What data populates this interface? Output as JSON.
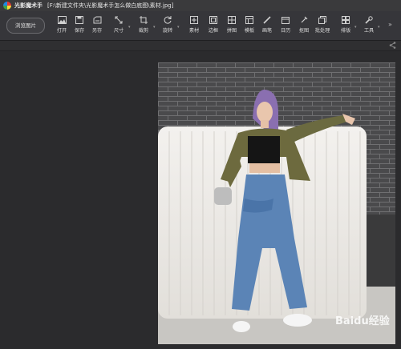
{
  "app": {
    "name": "光影魔术手",
    "file_path": "[F:\\新建文件夹\\光影魔术手怎么做白底图\\素材.jpg]"
  },
  "toolbar": {
    "browse_label": "浏览图片",
    "tools": [
      {
        "label": "打开",
        "icon": "image-icon"
      },
      {
        "label": "保存",
        "icon": "save-icon"
      },
      {
        "label": "另存",
        "icon": "save-as-icon"
      },
      {
        "label": "尺寸",
        "icon": "resize-icon"
      },
      {
        "label": "裁剪",
        "icon": "crop-icon"
      },
      {
        "label": "旋转",
        "icon": "rotate-icon"
      },
      {
        "label": "素材",
        "icon": "material-icon"
      },
      {
        "label": "边框",
        "icon": "frame-icon"
      },
      {
        "label": "拼图",
        "icon": "collage-icon"
      },
      {
        "label": "模板",
        "icon": "template-icon"
      },
      {
        "label": "画笔",
        "icon": "brush-icon"
      },
      {
        "label": "日历",
        "icon": "calendar-icon"
      },
      {
        "label": "抠图",
        "icon": "cutout-icon"
      },
      {
        "label": "批处理",
        "icon": "batch-icon"
      },
      {
        "label": "排版",
        "icon": "layout-icon"
      },
      {
        "label": "工具",
        "icon": "wrench-icon"
      }
    ],
    "more_icon": "double-chevron-right-icon"
  },
  "subbar": {
    "share_icon": "share-icon"
  },
  "watermark": "Baidu经验",
  "colors": {
    "background": "#2b2b2d",
    "toolbar": "#36363a",
    "titlebar": "#3a3a3c"
  }
}
